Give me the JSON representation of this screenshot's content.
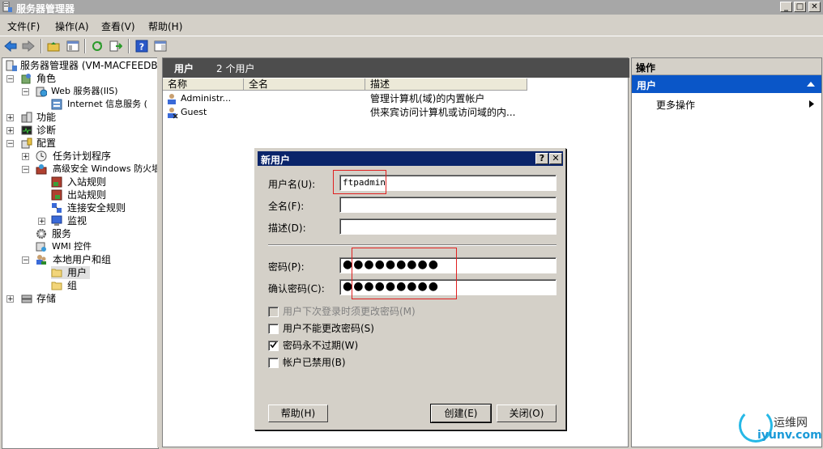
{
  "window": {
    "title": "服务器管理器",
    "minimize": "_",
    "maximize": "□",
    "close": "✕"
  },
  "menu": [
    "文件(F)",
    "操作(A)",
    "查看(V)",
    "帮助(H)"
  ],
  "tree": [
    {
      "label": "服务器管理器 (VM-MACFEEDBSJ)",
      "exp": ""
    },
    {
      "label": "角色",
      "exp": "−"
    },
    {
      "label": "Web 服务器(IIS)",
      "exp": "−"
    },
    {
      "label": "Internet 信息服务 (",
      "exp": ""
    },
    {
      "label": "功能",
      "exp": "+"
    },
    {
      "label": "诊断",
      "exp": "+"
    },
    {
      "label": "配置",
      "exp": "−"
    },
    {
      "label": "任务计划程序",
      "exp": "+"
    },
    {
      "label": "高级安全 Windows 防火墙",
      "exp": "−"
    },
    {
      "label": "入站规则",
      "exp": ""
    },
    {
      "label": "出站规则",
      "exp": ""
    },
    {
      "label": "连接安全规则",
      "exp": ""
    },
    {
      "label": "监视",
      "exp": "+"
    },
    {
      "label": "服务",
      "exp": ""
    },
    {
      "label": "WMI 控件",
      "exp": ""
    },
    {
      "label": "本地用户和组",
      "exp": "−"
    },
    {
      "label": "用户",
      "exp": ""
    },
    {
      "label": "组",
      "exp": ""
    },
    {
      "label": "存储",
      "exp": "+"
    }
  ],
  "center": {
    "title": "用户",
    "count": "2 个用户",
    "columns": [
      "名称",
      "全名",
      "描述"
    ],
    "rows": [
      {
        "name": "Administr...",
        "fullname": "",
        "desc": "管理计算机(域)的内置帐户"
      },
      {
        "name": "Guest",
        "fullname": "",
        "desc": "供来宾访问计算机或访问域的内..."
      }
    ]
  },
  "actions": {
    "title": "操作",
    "section": "用户",
    "item": "更多操作"
  },
  "dialog": {
    "title": "新用户",
    "help_btn": "?",
    "close_btn": "✕",
    "username_label": "用户名(U):",
    "username_value": "ftpadmin",
    "fullname_label": "全名(F):",
    "fullname_value": "",
    "desc_label": "描述(D):",
    "desc_value": "",
    "password_label": "密码(P):",
    "password_value": "●●●●●●●●●",
    "confirm_label": "确认密码(C):",
    "confirm_value": "●●●●●●●●●",
    "checkboxes": [
      {
        "label": "用户下次登录时须更改密码(M)",
        "checked": false,
        "disabled": true
      },
      {
        "label": "用户不能更改密码(S)",
        "checked": false,
        "disabled": false
      },
      {
        "label": "密码永不过期(W)",
        "checked": true,
        "disabled": false
      },
      {
        "label": "帐户已禁用(B)",
        "checked": false,
        "disabled": false
      }
    ],
    "help_button": "帮助(H)",
    "create_button": "创建(E)",
    "close_button": "关闭(O)"
  },
  "watermark": {
    "name": "运维网",
    "url": "iyunv.com"
  }
}
